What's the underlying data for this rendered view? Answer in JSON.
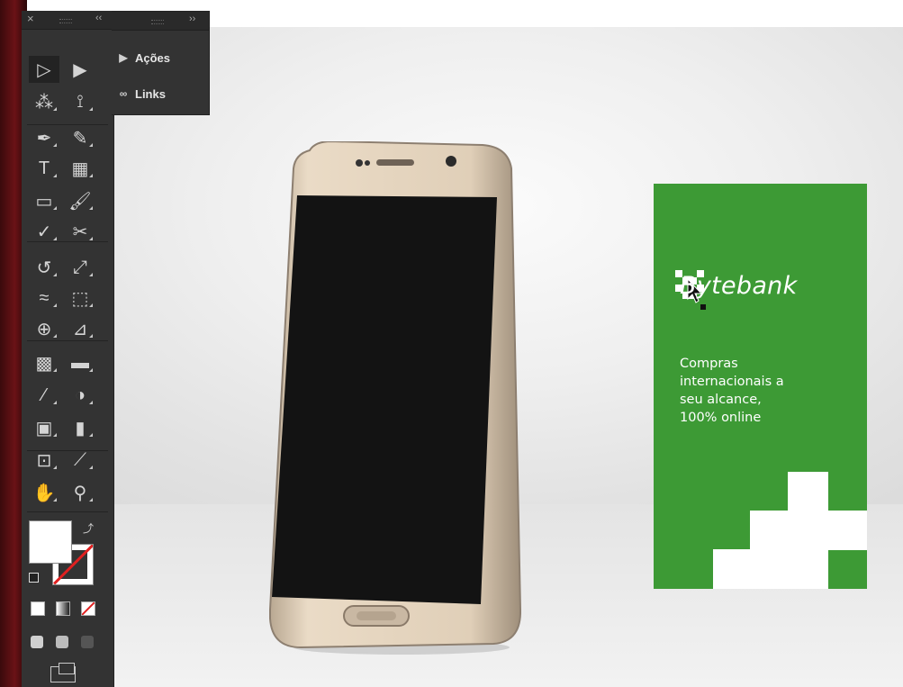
{
  "toolbar": {
    "close_icon": "×",
    "collapse_icon": "‹‹",
    "tools": [
      {
        "name": "selection-tool",
        "glyph": "▷"
      },
      {
        "name": "direct-selection-tool",
        "glyph": "▶"
      },
      {
        "name": "magic-wand-tool",
        "glyph": "⁂"
      },
      {
        "name": "lasso-tool",
        "glyph": "⟟"
      },
      {
        "name": "pen-tool",
        "glyph": "✒"
      },
      {
        "name": "curvature-tool",
        "glyph": "✎"
      },
      {
        "name": "type-tool",
        "glyph": "T"
      },
      {
        "name": "rectangular-grid-tool",
        "glyph": "▦"
      },
      {
        "name": "rectangle-tool",
        "glyph": "▭"
      },
      {
        "name": "paintbrush-tool",
        "glyph": "🖌"
      },
      {
        "name": "shaper-tool",
        "glyph": "✓"
      },
      {
        "name": "scissors-tool",
        "glyph": "✂"
      },
      {
        "name": "rotate-tool",
        "glyph": "↺"
      },
      {
        "name": "scale-tool",
        "glyph": "⤢"
      },
      {
        "name": "warp-tool",
        "glyph": "≈"
      },
      {
        "name": "free-transform-tool",
        "glyph": "⬚"
      },
      {
        "name": "shape-builder-tool",
        "glyph": "⊕"
      },
      {
        "name": "perspective-grid-tool",
        "glyph": "⊿"
      },
      {
        "name": "mesh-tool",
        "glyph": "▩"
      },
      {
        "name": "gradient-tool",
        "glyph": "▬"
      },
      {
        "name": "eyedropper-tool",
        "glyph": "⁄"
      },
      {
        "name": "blend-tool",
        "glyph": "◑"
      },
      {
        "name": "symbol-sprayer-tool",
        "glyph": "▣"
      },
      {
        "name": "column-graph-tool",
        "glyph": "▮"
      },
      {
        "name": "artboard-tool",
        "glyph": "⊡"
      },
      {
        "name": "slice-tool",
        "glyph": "⟋"
      },
      {
        "name": "hand-tool",
        "glyph": "✋"
      },
      {
        "name": "zoom-tool",
        "glyph": "⚲"
      }
    ],
    "fill_color": "#ffffff",
    "stroke_color": "none"
  },
  "panel": {
    "expand_icon": "››",
    "items": [
      {
        "icon": "▶",
        "label": "Ações"
      },
      {
        "icon": "∞",
        "label": "Links"
      }
    ]
  },
  "artwork": {
    "phone_body_color": "#e3d3bd",
    "phone_screen_color": "#131313",
    "banner": {
      "background": "#3d9a35",
      "brand": "Bytebank",
      "tagline": [
        "Compras",
        "internacionais a",
        "seu alcance,",
        "100% online"
      ]
    }
  }
}
